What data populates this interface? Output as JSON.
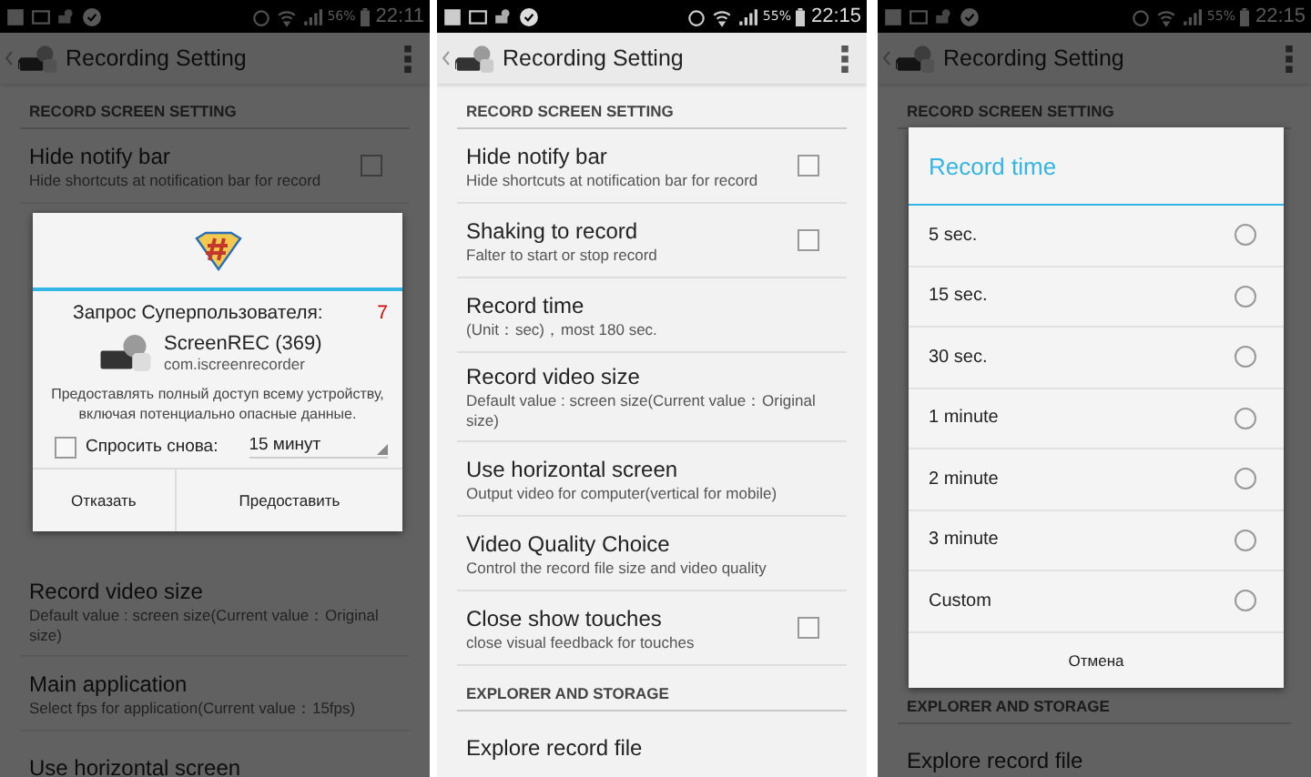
{
  "screens": [
    {
      "status_bar": {
        "battery": "56%",
        "time": "22:11"
      },
      "app_bar": {
        "title": "Recording Setting"
      },
      "list_top": [
        {
          "kind": "header",
          "title": "RECORD SCREEN SETTING"
        },
        {
          "kind": "checkbox",
          "title": "Hide notify bar",
          "subtitle": "Hide shortcuts at notification bar for record",
          "checked": false
        }
      ],
      "list_bottom": [
        {
          "kind": "plain",
          "title": "Record video size",
          "subtitle": "Default value : screen size(Current value：Original size)"
        },
        {
          "kind": "plain",
          "title": "Main application",
          "subtitle": "Select fps for application(Current value：15fps)"
        },
        {
          "kind": "plain",
          "title": "Use horizontal screen"
        }
      ],
      "dialog": {
        "kind": "superuser",
        "request": "Запрос Суперпользователя:",
        "count": "7",
        "app_name": "ScreenREC (369)",
        "package": "com.iscreenrecorder",
        "message": "Предоставлять полный доступ всему устройству, включая потенциально опасные данные.",
        "ask_again": {
          "label": "Спросить снова:",
          "checked": false
        },
        "duration": "15 минут",
        "buttons": [
          "Отказать",
          "Предоставить"
        ]
      }
    },
    {
      "status_bar": {
        "battery": "55%",
        "time": "22:15"
      },
      "app_bar": {
        "title": "Recording Setting"
      },
      "list_top": [
        {
          "kind": "header",
          "title": "RECORD SCREEN SETTING"
        },
        {
          "kind": "checkbox",
          "title": "Hide notify bar",
          "subtitle": "Hide shortcuts at notification bar for record",
          "checked": false
        },
        {
          "kind": "checkbox",
          "title": "Shaking to record",
          "subtitle": "Falter to start or stop record",
          "checked": false
        },
        {
          "kind": "plain",
          "title": "Record time",
          "subtitle": "(Unit：sec)，most 180 sec."
        },
        {
          "kind": "plain",
          "title": "Record video size",
          "subtitle": "Default value : screen size(Current value：Original size)"
        },
        {
          "kind": "plain",
          "title": "Use horizontal screen",
          "subtitle": "Output video for computer(vertical for mobile)"
        },
        {
          "kind": "plain",
          "title": "Video Quality Choice",
          "subtitle": "Control the record file size and video quality"
        },
        {
          "kind": "checkbox",
          "title": "Close show touches",
          "subtitle": "close visual feedback for touches",
          "checked": false
        },
        {
          "kind": "header",
          "title": "EXPLORER AND STORAGE"
        },
        {
          "kind": "plain",
          "title": "Explore record file"
        }
      ]
    },
    {
      "status_bar": {
        "battery": "55%",
        "time": "22:15"
      },
      "app_bar": {
        "title": "Recording Setting"
      },
      "list_top": [
        {
          "kind": "header",
          "title": "RECORD SCREEN SETTING"
        }
      ],
      "list_bottom": [
        {
          "kind": "header",
          "title": "EXPLORER AND STORAGE"
        },
        {
          "kind": "plain",
          "title": "Explore record file"
        }
      ],
      "dialog": {
        "kind": "choice",
        "title": "Record time",
        "options": [
          {
            "label": "5 sec.",
            "selected": false
          },
          {
            "label": "15 sec.",
            "selected": false
          },
          {
            "label": "30 sec.",
            "selected": false
          },
          {
            "label": "1 minute",
            "selected": false
          },
          {
            "label": "2 minute",
            "selected": false
          },
          {
            "label": "3 minute",
            "selected": false
          },
          {
            "label": "Custom",
            "selected": false
          }
        ],
        "cancel": "Отмена"
      }
    }
  ]
}
